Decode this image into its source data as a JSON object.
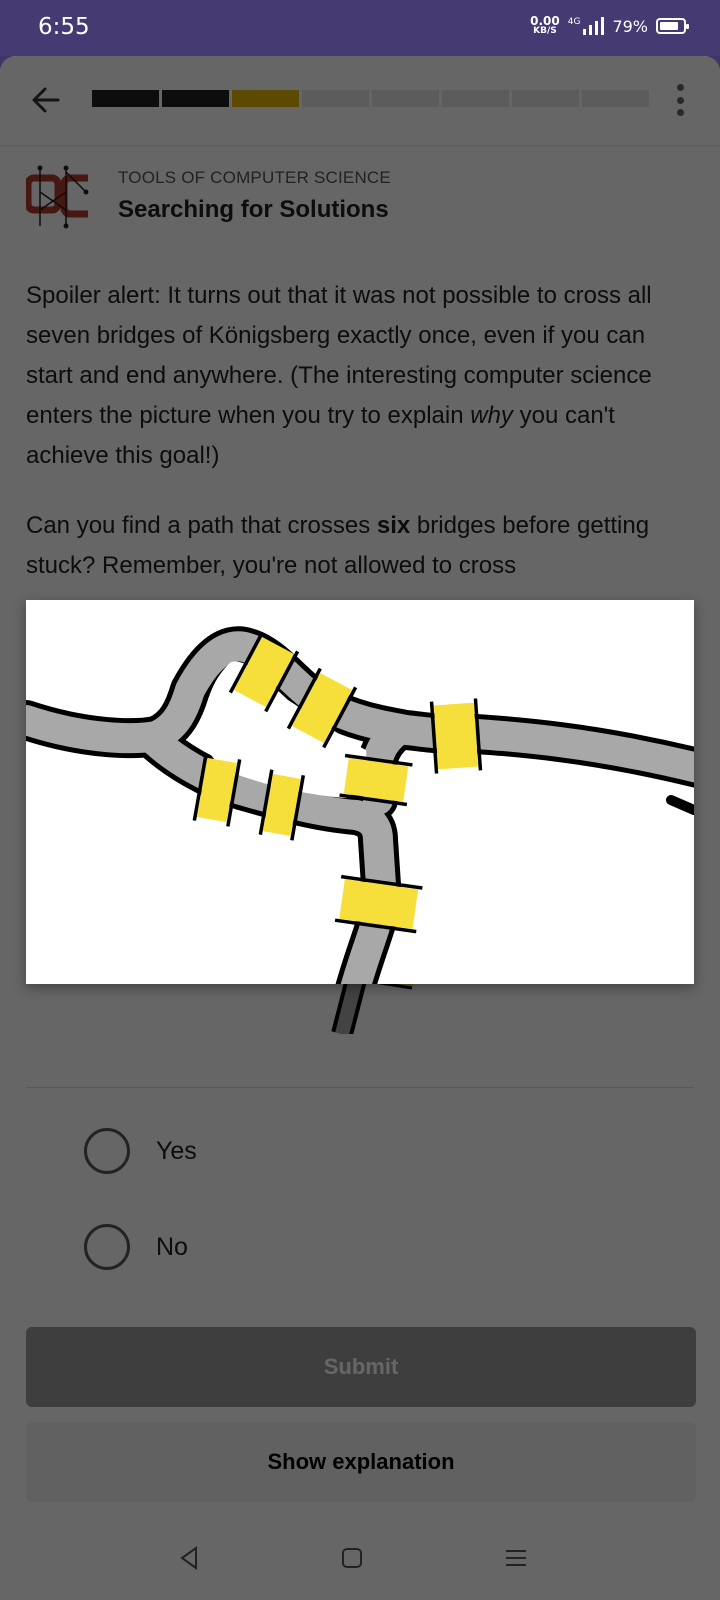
{
  "status_bar": {
    "time": "6:55",
    "net_value": "0.00",
    "net_unit": "KB/S",
    "network_type": "4G",
    "battery": "79%"
  },
  "header": {
    "progress": {
      "total_segments": 8,
      "completed": 2,
      "current": 3
    }
  },
  "course": {
    "kicker": "TOOLS OF COMPUTER SCIENCE",
    "title": "Searching for Solutions"
  },
  "content": {
    "p1_text": "Spoiler alert: It turns out that it was not possible to cross all seven bridges of Königsberg exactly once, even if you can start and end anywhere. (The interesting computer science enters the picture when you try to explain ",
    "p1_em": "why",
    "p1_tail": " you can't achieve this goal!)",
    "p2_a": "Can you find a path that crosses ",
    "p2_b": "six",
    "p2_c": " bridges before getting stuck? Remember, you're not allowed to cross"
  },
  "question": {
    "options": [
      "Yes",
      "No"
    ]
  },
  "actions": {
    "submit": "Submit",
    "explanation": "Show explanation"
  },
  "colors": {
    "status_bar": "#463a73",
    "progress_current": "#e6b800",
    "bridge_yellow": "#f6df3a",
    "river_gray": "#a8a8a8"
  },
  "icons": {
    "back": "arrow-left-icon",
    "menu": "more-vertical-icon",
    "nav_back": "triangle-left-icon",
    "nav_home": "square-icon",
    "nav_recent": "menu-lines-icon"
  }
}
